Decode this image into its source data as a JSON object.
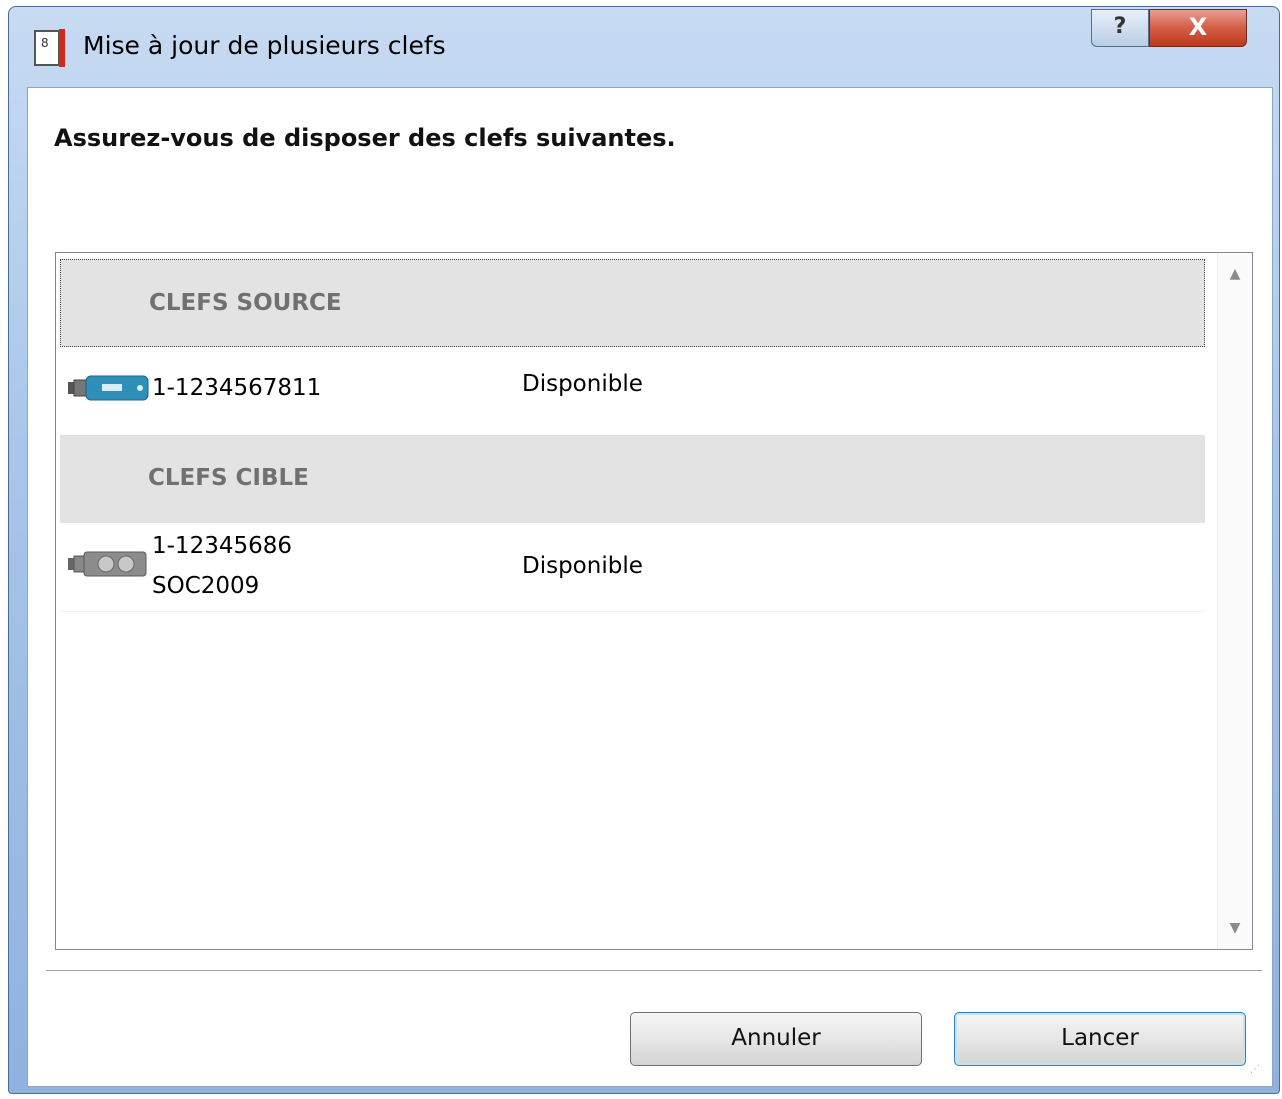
{
  "window": {
    "title": "Mise à jour de plusieurs clefs",
    "help_label": "?",
    "close_label": "X"
  },
  "heading": "Assurez-vous de disposer des clefs suivantes.",
  "groups": [
    {
      "label": "CLEFS SOURCE",
      "items": [
        {
          "id_line1": "1-1234567811",
          "id_line2": "",
          "status": "Disponible",
          "icon": "usb-key-blue-icon"
        }
      ]
    },
    {
      "label": "CLEFS CIBLE",
      "items": [
        {
          "id_line1": "1-12345686",
          "id_line2": "SOC2009",
          "status": "Disponible",
          "icon": "usb-key-gray-icon"
        }
      ]
    }
  ],
  "buttons": {
    "cancel": "Annuler",
    "launch": "Lancer"
  },
  "colors": {
    "title_bar": "#a9c6ea",
    "close_red": "#c0381c",
    "group_header_bg": "#e3e3e3",
    "group_header_text": "#707070",
    "usb_blue": "#2e8fb8"
  }
}
